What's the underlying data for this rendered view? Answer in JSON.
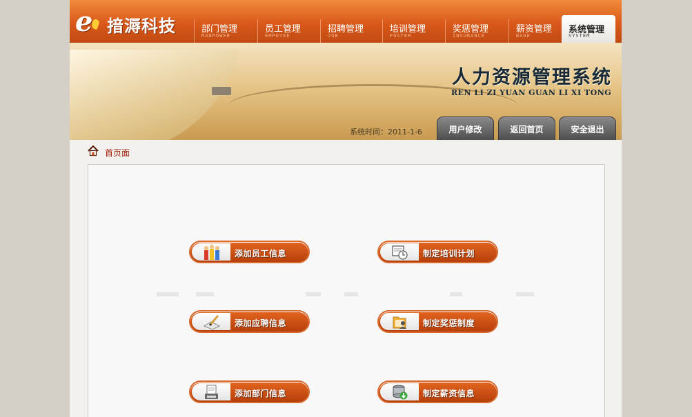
{
  "logo": {
    "mark": "e",
    "name": "揞溽科技"
  },
  "nav": [
    {
      "cn": "部门管理",
      "en": "MANPOWER"
    },
    {
      "cn": "员工管理",
      "en": "EMPOYEE"
    },
    {
      "cn": "招聘管理",
      "en": "JOB"
    },
    {
      "cn": "培训管理",
      "en": "FOSTER"
    },
    {
      "cn": "奖惩管理",
      "en": "INSURANCE"
    },
    {
      "cn": "薪资管理",
      "en": "WAGE"
    },
    {
      "cn": "系统管理",
      "en": "SYSTEM",
      "active": true
    }
  ],
  "banner": {
    "title": "人力资源管理系统",
    "subtitle": "REN LI ZI YUAN GUAN LI XI TONG",
    "system_time": "系统时间：2011-1-6",
    "buttons": [
      "用户修改",
      "返回首页",
      "安全退出"
    ]
  },
  "breadcrumb": {
    "label": "首页面"
  },
  "actions": [
    {
      "label": "添加员工信息",
      "icon": "people-icon"
    },
    {
      "label": "制定培训计划",
      "icon": "schedule-clock-icon"
    },
    {
      "label": "添加应聘信息",
      "icon": "pen-paper-icon"
    },
    {
      "label": "制定奖惩制度",
      "icon": "folder-user-icon"
    },
    {
      "label": "添加部门信息",
      "icon": "document-printer-icon"
    },
    {
      "label": "制定薪资信息",
      "icon": "database-download-icon"
    }
  ],
  "colors": {
    "accent": "#d9591a",
    "banner_text": "#182a38",
    "breadcrumb": "#a11c0c"
  }
}
